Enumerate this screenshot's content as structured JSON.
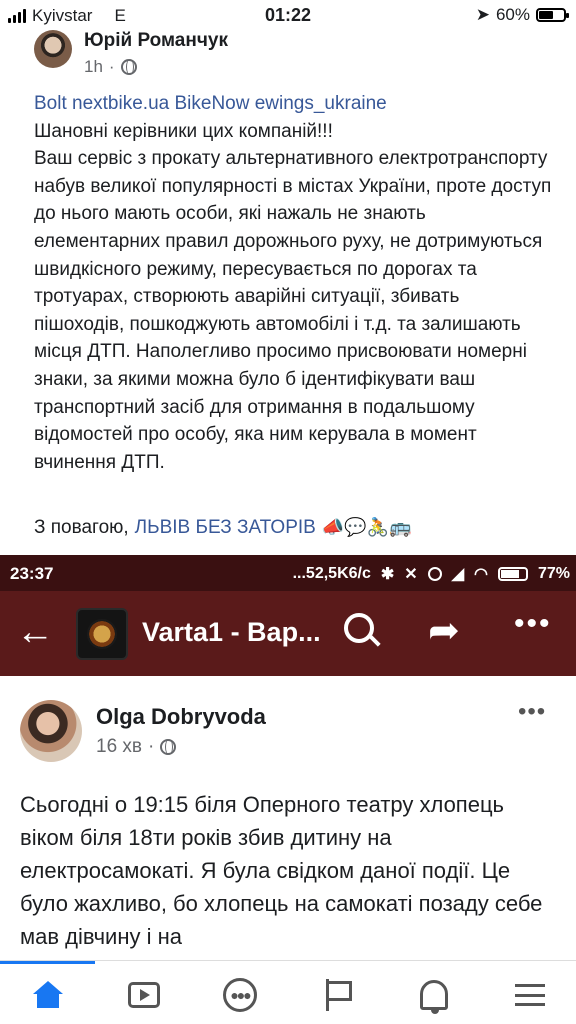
{
  "ios_status": {
    "carrier": "Kyivstar",
    "network": "E",
    "time": "01:22",
    "battery": "60%",
    "battery_level": 0.6
  },
  "post1": {
    "author": "Юрій Романчук",
    "time": "1h",
    "dot": "·",
    "tags": "Bolt nextbike.ua BikeNow ewings_ukraine",
    "body": "Шановні керівники цих компаній!!!\nВаш сервіс з прокату альтернативного електротранспорту  набув великої популярності в містах України, проте доступ до нього мають особи, які нажаль не знають елементарних правил дорожнього руху, не дотримуються швидкісного режиму, пересувається по дорогах та тротуарах, створюють аварійні ситуації, збивать пішоходів, пошкоджують автомобілі і т.д. та залишають місця ДТП. Наполегливо просимо присвоювати номерні знаки, за якими можна було б ідентифікувати ваш транспортний засіб для отримання в подальшому відомостей про особу, яка ним керувала в момент вчинення ДТП.",
    "sign_prefix": "З повагою,",
    "sign_link": "ЛЬВІВ БЕЗ ЗАТОРІВ",
    "emojis": "📣💬🚴🚌"
  },
  "android_status": {
    "time": "23:37",
    "speed": "...52,5K6/c",
    "battery": "77%",
    "battery_level": 0.77
  },
  "app_bar": {
    "title": "Varta1 - Вар..."
  },
  "post2": {
    "author": "Olga Dobryvoda",
    "time": "16 хв",
    "dot": "·",
    "body": "Сьогодні о 19:15 біля Оперного театру хлопець віком біля 18ти років збив дитину на електросамокаті. Я була свідком даної події. Це було жахливо, бо хлопець на самокаті позаду себе мав дівчину і на"
  },
  "tabbar": {
    "active": "home"
  }
}
